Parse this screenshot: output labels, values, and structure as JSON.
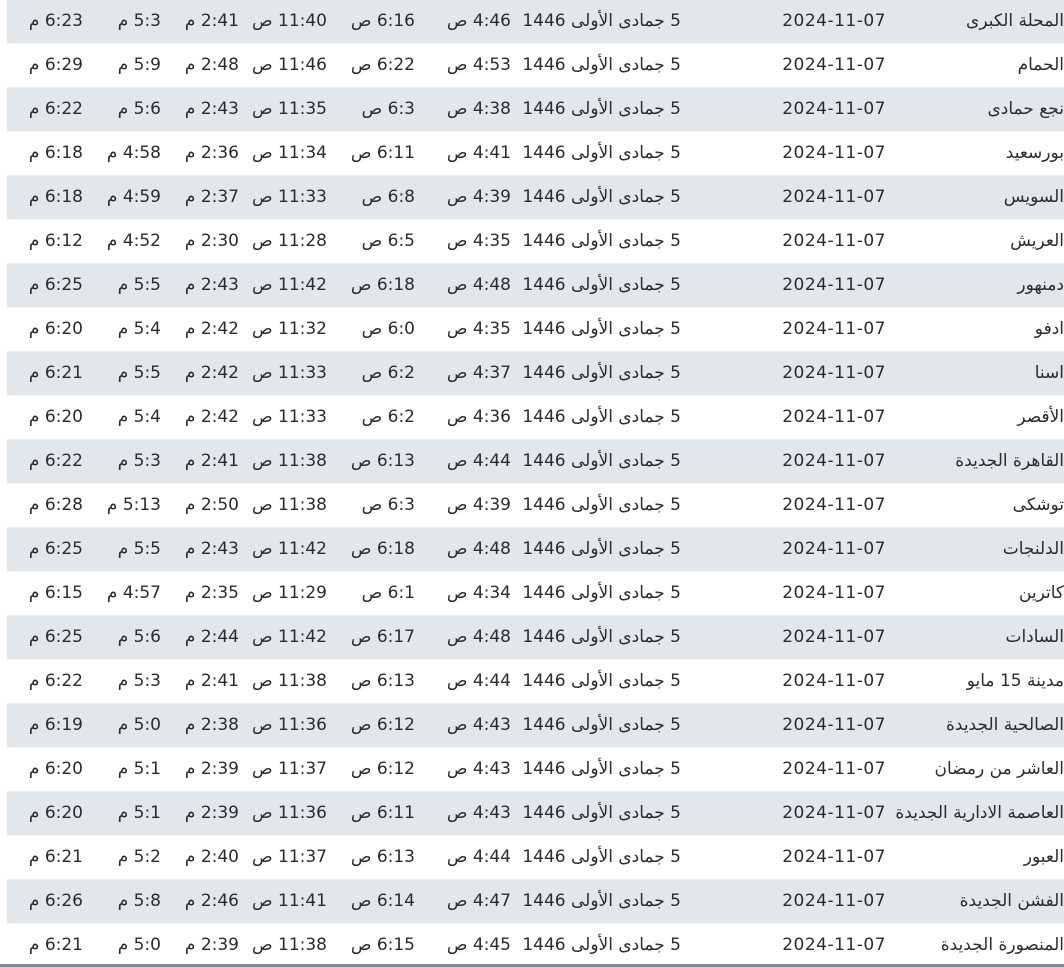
{
  "rows": [
    {
      "city": "المحلة الكبرى",
      "date": "2024-11-07",
      "hijri": "5 جمادى الأولى 1446",
      "fajr": "4:46 ص",
      "sunrise": "6:16 ص",
      "dhuhr": "11:40 ص",
      "asr": "2:41 م",
      "maghrib": "5:3 م",
      "isha": "6:23 م"
    },
    {
      "city": "الحمام",
      "date": "2024-11-07",
      "hijri": "5 جمادى الأولى 1446",
      "fajr": "4:53 ص",
      "sunrise": "6:22 ص",
      "dhuhr": "11:46 ص",
      "asr": "2:48 م",
      "maghrib": "5:9 م",
      "isha": "6:29 م"
    },
    {
      "city": "نجع حمادى",
      "date": "2024-11-07",
      "hijri": "5 جمادى الأولى 1446",
      "fajr": "4:38 ص",
      "sunrise": "6:3 ص",
      "dhuhr": "11:35 ص",
      "asr": "2:43 م",
      "maghrib": "5:6 م",
      "isha": "6:22 م"
    },
    {
      "city": "بورسعيد",
      "date": "2024-11-07",
      "hijri": "5 جمادى الأولى 1446",
      "fajr": "4:41 ص",
      "sunrise": "6:11 ص",
      "dhuhr": "11:34 ص",
      "asr": "2:36 م",
      "maghrib": "4:58 م",
      "isha": "6:18 م"
    },
    {
      "city": "السويس",
      "date": "2024-11-07",
      "hijri": "5 جمادى الأولى 1446",
      "fajr": "4:39 ص",
      "sunrise": "6:8 ص",
      "dhuhr": "11:33 ص",
      "asr": "2:37 م",
      "maghrib": "4:59 م",
      "isha": "6:18 م"
    },
    {
      "city": "العريش",
      "date": "2024-11-07",
      "hijri": "5 جمادى الأولى 1446",
      "fajr": "4:35 ص",
      "sunrise": "6:5 ص",
      "dhuhr": "11:28 ص",
      "asr": "2:30 م",
      "maghrib": "4:52 م",
      "isha": "6:12 م"
    },
    {
      "city": "دمنهور",
      "date": "2024-11-07",
      "hijri": "5 جمادى الأولى 1446",
      "fajr": "4:48 ص",
      "sunrise": "6:18 ص",
      "dhuhr": "11:42 ص",
      "asr": "2:43 م",
      "maghrib": "5:5 م",
      "isha": "6:25 م"
    },
    {
      "city": "ادفو",
      "date": "2024-11-07",
      "hijri": "5 جمادى الأولى 1446",
      "fajr": "4:35 ص",
      "sunrise": "6:0 ص",
      "dhuhr": "11:32 ص",
      "asr": "2:42 م",
      "maghrib": "5:4 م",
      "isha": "6:20 م"
    },
    {
      "city": "اسنا",
      "date": "2024-11-07",
      "hijri": "5 جمادى الأولى 1446",
      "fajr": "4:37 ص",
      "sunrise": "6:2 ص",
      "dhuhr": "11:33 ص",
      "asr": "2:42 م",
      "maghrib": "5:5 م",
      "isha": "6:21 م"
    },
    {
      "city": "الأقصر",
      "date": "2024-11-07",
      "hijri": "5 جمادى الأولى 1446",
      "fajr": "4:36 ص",
      "sunrise": "6:2 ص",
      "dhuhr": "11:33 ص",
      "asr": "2:42 م",
      "maghrib": "5:4 م",
      "isha": "6:20 م"
    },
    {
      "city": "القاهرة الجديدة",
      "date": "2024-11-07",
      "hijri": "5 جمادى الأولى 1446",
      "fajr": "4:44 ص",
      "sunrise": "6:13 ص",
      "dhuhr": "11:38 ص",
      "asr": "2:41 م",
      "maghrib": "5:3 م",
      "isha": "6:22 م"
    },
    {
      "city": "توشكى",
      "date": "2024-11-07",
      "hijri": "5 جمادى الأولى 1446",
      "fajr": "4:39 ص",
      "sunrise": "6:3 ص",
      "dhuhr": "11:38 ص",
      "asr": "2:50 م",
      "maghrib": "5:13 م",
      "isha": "6:28 م"
    },
    {
      "city": "الدلنجات",
      "date": "2024-11-07",
      "hijri": "5 جمادى الأولى 1446",
      "fajr": "4:48 ص",
      "sunrise": "6:18 ص",
      "dhuhr": "11:42 ص",
      "asr": "2:43 م",
      "maghrib": "5:5 م",
      "isha": "6:25 م"
    },
    {
      "city": "كاترين",
      "date": "2024-11-07",
      "hijri": "5 جمادى الأولى 1446",
      "fajr": "4:34 ص",
      "sunrise": "6:1 ص",
      "dhuhr": "11:29 ص",
      "asr": "2:35 م",
      "maghrib": "4:57 م",
      "isha": "6:15 م"
    },
    {
      "city": "السادات",
      "date": "2024-11-07",
      "hijri": "5 جمادى الأولى 1446",
      "fajr": "4:48 ص",
      "sunrise": "6:17 ص",
      "dhuhr": "11:42 ص",
      "asr": "2:44 م",
      "maghrib": "5:6 م",
      "isha": "6:25 م"
    },
    {
      "city": "مدينة 15 مايو",
      "date": "2024-11-07",
      "hijri": "5 جمادى الأولى 1446",
      "fajr": "4:44 ص",
      "sunrise": "6:13 ص",
      "dhuhr": "11:38 ص",
      "asr": "2:41 م",
      "maghrib": "5:3 م",
      "isha": "6:22 م"
    },
    {
      "city": "الصالحية الجديدة",
      "date": "2024-11-07",
      "hijri": "5 جمادى الأولى 1446",
      "fajr": "4:43 ص",
      "sunrise": "6:12 ص",
      "dhuhr": "11:36 ص",
      "asr": "2:38 م",
      "maghrib": "5:0 م",
      "isha": "6:19 م"
    },
    {
      "city": "العاشر من رمضان",
      "date": "2024-11-07",
      "hijri": "5 جمادى الأولى 1446",
      "fajr": "4:43 ص",
      "sunrise": "6:12 ص",
      "dhuhr": "11:37 ص",
      "asr": "2:39 م",
      "maghrib": "5:1 م",
      "isha": "6:20 م"
    },
    {
      "city": "العاصمة الادارية الجديدة",
      "date": "2024-11-07",
      "hijri": "5 جمادى الأولى 1446",
      "fajr": "4:43 ص",
      "sunrise": "6:11 ص",
      "dhuhr": "11:36 ص",
      "asr": "2:39 م",
      "maghrib": "5:1 م",
      "isha": "6:20 م"
    },
    {
      "city": "العبور",
      "date": "2024-11-07",
      "hijri": "5 جمادى الأولى 1446",
      "fajr": "4:44 ص",
      "sunrise": "6:13 ص",
      "dhuhr": "11:37 ص",
      "asr": "2:40 م",
      "maghrib": "5:2 م",
      "isha": "6:21 م"
    },
    {
      "city": "الفشن الجديدة",
      "date": "2024-11-07",
      "hijri": "5 جمادى الأولى 1446",
      "fajr": "4:47 ص",
      "sunrise": "6:14 ص",
      "dhuhr": "11:41 ص",
      "asr": "2:46 م",
      "maghrib": "5:8 م",
      "isha": "6:26 م"
    },
    {
      "city": "المنصورة الجديدة",
      "date": "2024-11-07",
      "hijri": "5 جمادى الأولى 1446",
      "fajr": "4:45 ص",
      "sunrise": "6:15 ص",
      "dhuhr": "11:38 ص",
      "asr": "2:39 م",
      "maghrib": "5:0 م",
      "isha": "6:21 م"
    }
  ]
}
